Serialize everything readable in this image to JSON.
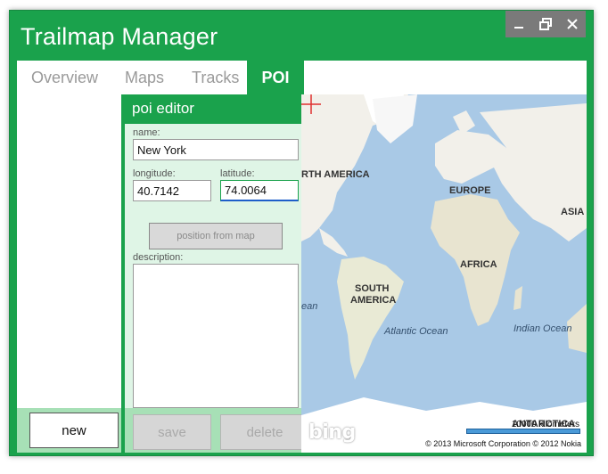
{
  "app": {
    "title": "Trailmap Manager"
  },
  "window_controls": {
    "minimize": "▁",
    "maximize": "🗗",
    "close": "✕"
  },
  "tabs": [
    {
      "label": "Overview",
      "active": false
    },
    {
      "label": "Maps",
      "active": false
    },
    {
      "label": "Tracks",
      "active": false
    },
    {
      "label": "POI",
      "active": true
    }
  ],
  "left_panel": {
    "new_label": "new"
  },
  "poi_editor": {
    "header": "poi editor",
    "name_label": "name:",
    "name_value": "New York",
    "longitude_label": "longitude:",
    "longitude_value": "40.7142",
    "latitude_label": "latitude:",
    "latitude_value": "74.0064",
    "position_button": "position from map",
    "description_label": "description:",
    "description_value": "",
    "save_label": "save",
    "delete_label": "delete"
  },
  "map": {
    "labels": {
      "north_america": "RTH AMERICA",
      "europe": "EUROPE",
      "asia": "ASIA",
      "africa": "AFRICA",
      "south_america_1": "SOUTH",
      "south_america_2": "AMERICA",
      "antarctica": "ANTARCTICA",
      "atlantic": "Atlantic Ocean",
      "indian": "Indian Ocean",
      "pacific_fragment": "ean"
    },
    "scale_text": "10000 kilometers",
    "provider": "bing",
    "copyright": "© 2013 Microsoft Corporation   © 2012 Nokia"
  },
  "colors": {
    "accent": "#1aa24c",
    "panel_bg": "#dff5e6",
    "bottom_bar": "#a7e0b6",
    "ocean": "#a9c9e6",
    "land": "#f2f0ea",
    "crosshair": "#e03030"
  }
}
